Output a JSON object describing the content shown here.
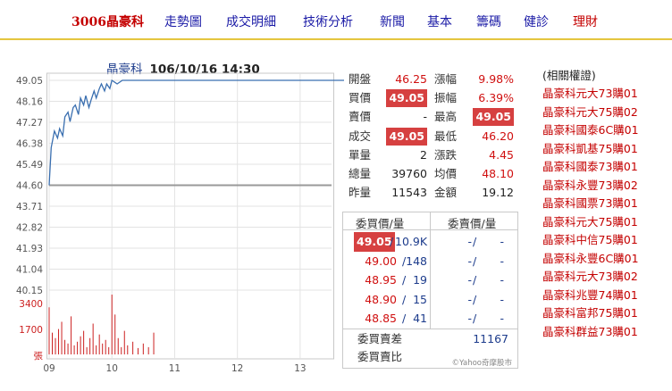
{
  "nav": {
    "items": [
      "3006晶豪科",
      "走勢圖",
      "成交明細",
      "技術分析",
      "新聞",
      "基本",
      "籌碼",
      "健診",
      "理財"
    ]
  },
  "chart": {
    "symbol": "晶豪科",
    "datetime": "106/10/16 14:30",
    "y_tick_labels": [
      "49.05",
      "48.16",
      "47.27",
      "46.38",
      "45.49",
      "44.60",
      "43.71",
      "42.82",
      "41.93",
      "41.04",
      "40.15"
    ],
    "volume_tick_labels": [
      "3400",
      "1700",
      "張"
    ],
    "x_tick_labels": [
      "09",
      "10",
      "11",
      "12",
      "13"
    ],
    "credit": "©Yahoo奇摩股市"
  },
  "chart_data": {
    "type": "line",
    "title": "晶豪科 106/10/16 14:30",
    "x": [
      "09:00",
      "09:02",
      "09:05",
      "09:08",
      "09:10",
      "09:13",
      "09:15",
      "09:18",
      "09:20",
      "09:23",
      "09:25",
      "09:28",
      "09:30",
      "09:33",
      "09:35",
      "09:38",
      "09:40",
      "09:43",
      "09:45",
      "09:48",
      "09:50",
      "09:53",
      "09:55",
      "09:58",
      "10:00",
      "10:05",
      "10:10",
      "10:20",
      "10:40",
      "14:30"
    ],
    "series": [
      {
        "values": [
          44.6,
          46.2,
          46.9,
          46.6,
          47.0,
          46.7,
          47.5,
          47.7,
          47.3,
          47.9,
          48.0,
          47.6,
          48.3,
          48.0,
          48.4,
          47.9,
          48.2,
          48.6,
          48.3,
          48.7,
          48.9,
          48.6,
          48.9,
          48.7,
          49.05,
          48.9,
          49.05,
          49.05,
          49.05,
          49.05
        ]
      }
    ],
    "reference_price": 44.6,
    "ylim": [
      40.15,
      49.05
    ],
    "volume": {
      "ylim": [
        0,
        3400
      ],
      "x": [
        "09:00",
        "09:03",
        "09:06",
        "09:09",
        "09:12",
        "09:15",
        "09:18",
        "09:21",
        "09:24",
        "09:27",
        "09:30",
        "09:33",
        "09:36",
        "09:39",
        "09:42",
        "09:45",
        "09:48",
        "09:51",
        "09:54",
        "09:57",
        "10:00",
        "10:03",
        "10:06",
        "10:09",
        "10:12",
        "10:15",
        "10:20",
        "10:25",
        "10:30",
        "10:35",
        "10:40"
      ],
      "values": [
        2600,
        1200,
        900,
        1400,
        1800,
        800,
        600,
        2100,
        500,
        700,
        1000,
        1300,
        400,
        900,
        1700,
        500,
        1100,
        600,
        800,
        400,
        3300,
        2200,
        900,
        400,
        1300,
        500,
        700,
        350,
        600,
        400,
        1200
      ]
    },
    "xlim": [
      "09:00",
      "13:30"
    ]
  },
  "quote": {
    "rows": [
      {
        "l1": "開盤",
        "v1": "46.25",
        "l2": "漲幅",
        "v2": "9.98%"
      },
      {
        "l1": "買價",
        "v1": "49.05",
        "l2": "振幅",
        "v2": "6.39%"
      },
      {
        "l1": "賣價",
        "v1": "-",
        "l2": "最高",
        "v2": "49.05"
      },
      {
        "l1": "成交",
        "v1": "49.05",
        "l2": "最低",
        "v2": "46.20"
      },
      {
        "l1": "單量",
        "v1": "2",
        "l2": "漲跌",
        "v2": "4.45"
      },
      {
        "l1": "總量",
        "v1": "39760",
        "l2": "均價",
        "v2": "48.10"
      },
      {
        "l1": "昨量",
        "v1": "11543",
        "l2": "金額",
        "v2": "19.12"
      }
    ]
  },
  "orderbook": {
    "bid_header": "委買價/量",
    "ask_header": "委賣價/量",
    "rows": [
      {
        "bid_price": "49.05",
        "bid_vol": "10.9K",
        "ask_price": "-",
        "ask_vol": "-"
      },
      {
        "bid_price": "49.00",
        "bid_vol": "148",
        "ask_price": "-",
        "ask_vol": "-"
      },
      {
        "bid_price": "48.95",
        "bid_vol": "19",
        "ask_price": "-",
        "ask_vol": "-"
      },
      {
        "bid_price": "48.90",
        "bid_vol": "15",
        "ask_price": "-",
        "ask_vol": "-"
      },
      {
        "bid_price": "48.85",
        "bid_vol": "41",
        "ask_price": "-",
        "ask_vol": "-"
      }
    ],
    "diff_label": "委買賣差",
    "diff_value": "11167",
    "ratio_label": "委買賣比",
    "ratio_value": ""
  },
  "warrants": {
    "title": "(相關權證)",
    "items": [
      "晶豪科元大73購01",
      "晶豪科元大75購02",
      "晶豪科國泰6C購01",
      "晶豪科凱基75購01",
      "晶豪科國泰73購01",
      "晶豪科永豐73購02",
      "晶豪科國票73購01",
      "晶豪科元大75購01",
      "晶豪科中信75購01",
      "晶豪科永豐6C購01",
      "晶豪科元大73購02",
      "晶豪科兆豐74購01",
      "晶豪科富邦75購01",
      "晶豪科群益73購01"
    ]
  },
  "colors": {
    "price_line": "#3a6fb0",
    "reference_line": "#999999",
    "volume_bar": "#cc2020",
    "highlight": "#d64040",
    "up": "#d01010",
    "nav_link": "#1a1aa6"
  }
}
